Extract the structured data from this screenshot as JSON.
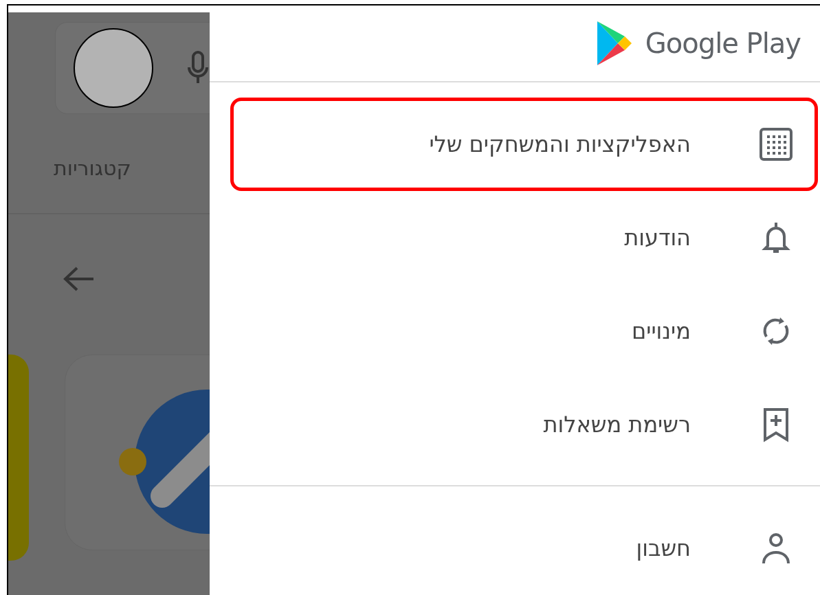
{
  "background": {
    "tab_label": "קטגוריות"
  },
  "drawer": {
    "logo_text": "Google Play",
    "items": [
      {
        "label": "האפליקציות והמשחקים שלי",
        "kind": "apps",
        "highlighted": true
      },
      {
        "label": "הודעות",
        "kind": "bell",
        "highlighted": false
      },
      {
        "label": "מינויים",
        "kind": "sync",
        "highlighted": false
      },
      {
        "label": "רשימת משאלות",
        "kind": "wishlist",
        "highlighted": false
      },
      {
        "label": "חשבון",
        "kind": "account",
        "highlighted": false
      }
    ]
  }
}
